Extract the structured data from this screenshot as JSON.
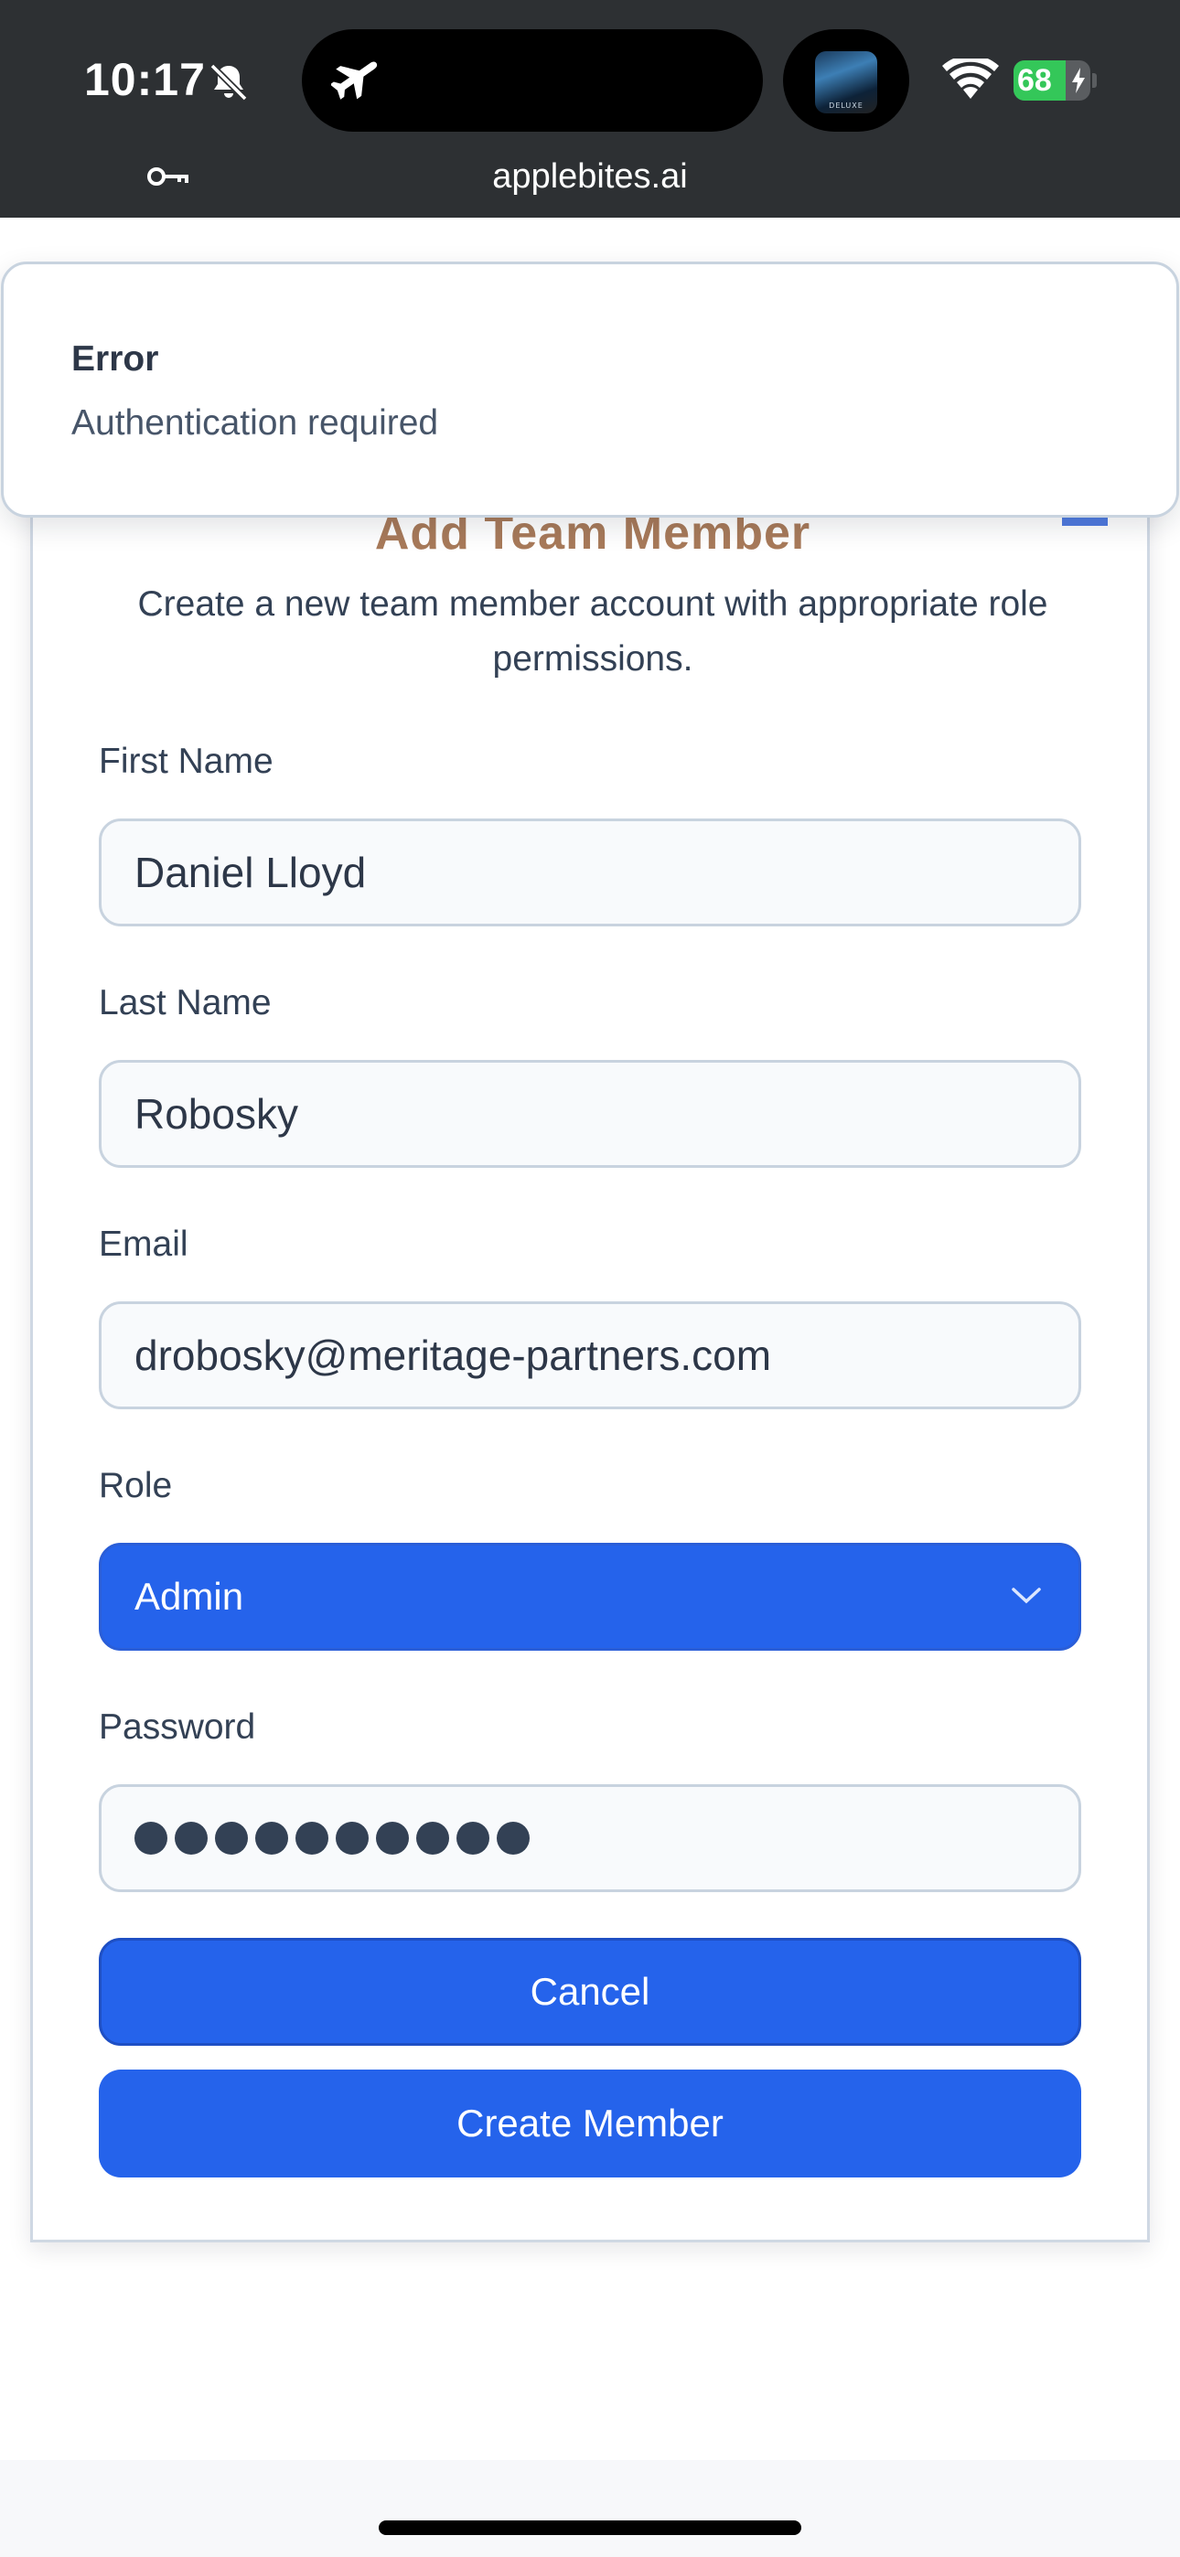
{
  "status_bar": {
    "time": "10:17",
    "battery_level": 68,
    "battery_text": "68",
    "url": "applebites.ai",
    "icons": [
      "bell-slash-icon",
      "airplane-icon",
      "wifi-icon",
      "battery-charging-icon",
      "key-icon"
    ],
    "app_thumb_text": "DELUXE"
  },
  "toast": {
    "title": "Error",
    "message": "Authentication required"
  },
  "form": {
    "title": "Add Team Member",
    "subtitle": "Create a new team member account with appropriate role permissions.",
    "first_name": {
      "label": "First Name",
      "value": "Daniel Lloyd"
    },
    "last_name": {
      "label": "Last Name",
      "value": "Robosky"
    },
    "email": {
      "label": "Email",
      "value": "drobosky@meritage-partners.com"
    },
    "role": {
      "label": "Role",
      "value": "Admin"
    },
    "password": {
      "label": "Password",
      "masked_length": 10
    },
    "cancel_label": "Cancel",
    "create_label": "Create Member"
  },
  "colors": {
    "primary": "#2563eb",
    "title_accent": "#a87a5a",
    "status_bar": "#2d3033",
    "battery_green": "#34c759"
  }
}
